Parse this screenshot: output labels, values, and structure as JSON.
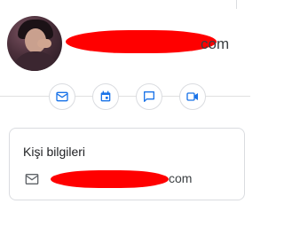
{
  "profile": {
    "email_visible_suffix": "com",
    "email_redacted": true
  },
  "actions": [
    {
      "icon": "mail-icon",
      "label": ""
    },
    {
      "icon": "calendar-icon",
      "label": ""
    },
    {
      "icon": "chat-icon",
      "label": ""
    },
    {
      "icon": "video-icon",
      "label": ""
    }
  ],
  "card": {
    "title": "Kişi bilgileri",
    "email_visible_suffix": "com"
  },
  "colors": {
    "accent": "#1a73e8",
    "redaction": "#ff0000",
    "border": "#dadce0"
  }
}
